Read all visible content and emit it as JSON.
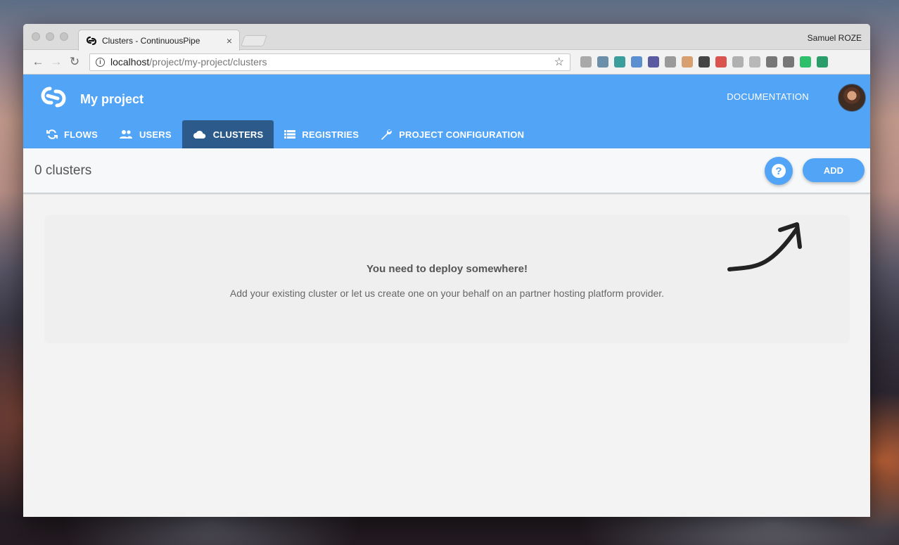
{
  "browser": {
    "tab_title": "Clusters - ContinuousPipe",
    "tab_close": "×",
    "profile_name": "Samuel ROZE",
    "url_host": "localhost",
    "url_path": "/project/my-project/clusters",
    "nav_back": "←",
    "nav_forward": "→",
    "nav_reload": "↻",
    "bookmark": "☆",
    "info": "i",
    "extensions": [
      {
        "name": "ext-1",
        "color": "#a9a9a9"
      },
      {
        "name": "ext-2",
        "color": "#6b8fa8"
      },
      {
        "name": "ext-3",
        "color": "#3b9e9c"
      },
      {
        "name": "ext-4",
        "color": "#5b8fd0"
      },
      {
        "name": "ext-5",
        "color": "#5a5aa0"
      },
      {
        "name": "ext-6",
        "color": "#9a9a9a"
      },
      {
        "name": "ext-7",
        "color": "#d8a070"
      },
      {
        "name": "ext-8",
        "color": "#444444"
      },
      {
        "name": "ext-9",
        "color": "#d9534f"
      },
      {
        "name": "ext-10",
        "color": "#b0b0b0"
      },
      {
        "name": "ext-11",
        "color": "#b8b8b8"
      },
      {
        "name": "ext-12",
        "color": "#777777"
      },
      {
        "name": "ext-13",
        "color": "#777777"
      },
      {
        "name": "ext-14",
        "color": "#2dbf6a"
      },
      {
        "name": "ext-15",
        "color": "#2a9d6a"
      }
    ]
  },
  "header": {
    "project_name": "My project",
    "documentation": "DOCUMENTATION",
    "brand_color": "#52a4f7",
    "active_tab_color": "#2c5a8a"
  },
  "nav": {
    "flows": "FLOWS",
    "users": "USERS",
    "clusters": "CLUSTERS",
    "registries": "REGISTRIES",
    "project_configuration": "PROJECT CONFIGURATION"
  },
  "toolbar": {
    "count": "0 clusters",
    "help": "?",
    "add": "ADD"
  },
  "empty_state": {
    "title": "You need to deploy somewhere!",
    "text": "Add your existing cluster or let us create one on your behalf on an partner hosting platform provider."
  }
}
